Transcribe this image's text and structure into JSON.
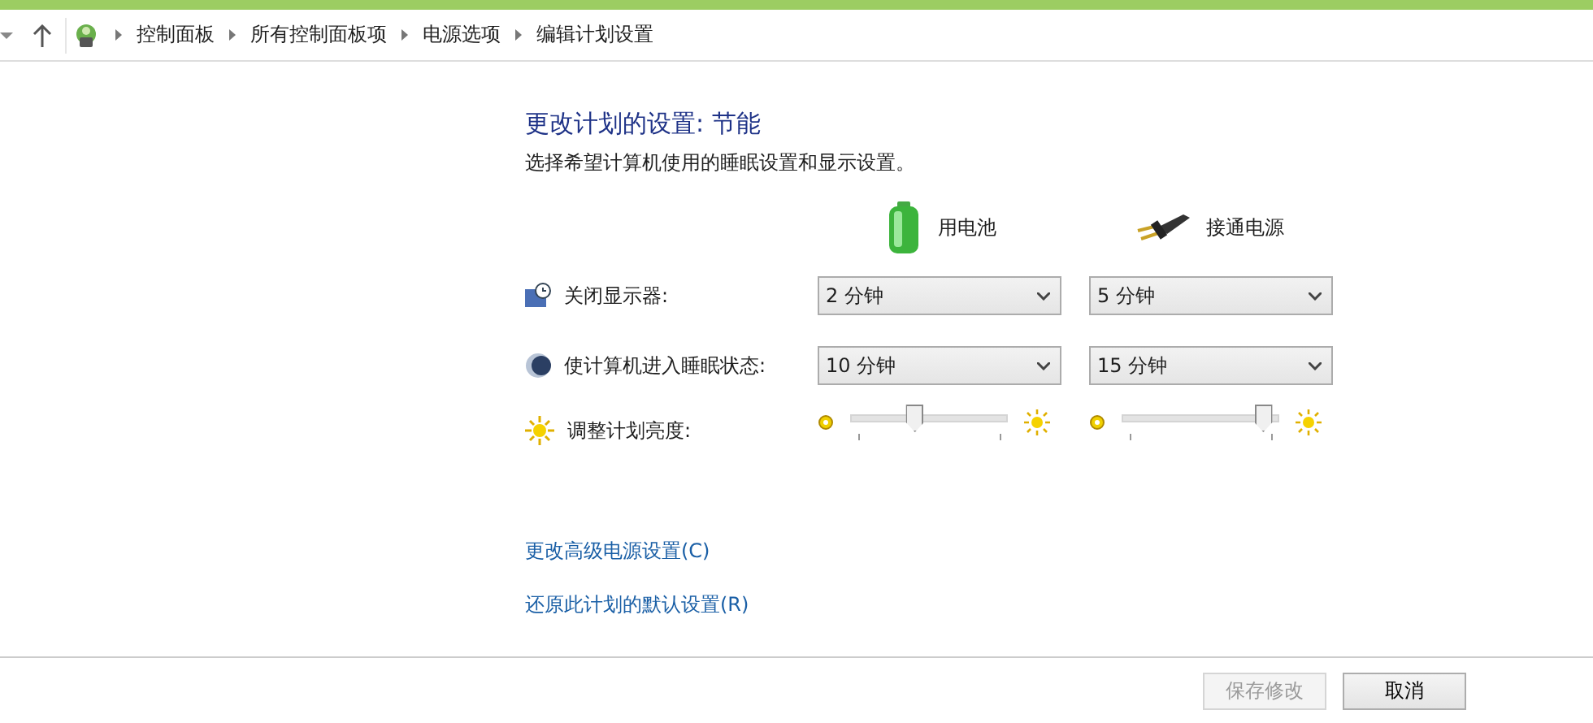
{
  "breadcrumb": [
    {
      "label": "控制面板"
    },
    {
      "label": "所有控制面板项"
    },
    {
      "label": "电源选项"
    },
    {
      "label": "编辑计划设置"
    }
  ],
  "heading": "更改计划的设置: 节能",
  "subtitle": "选择希望计算机使用的睡眠设置和显示设置。",
  "columns": [
    {
      "kind": "battery",
      "label": "用电池"
    },
    {
      "kind": "plug",
      "label": "接通电源"
    }
  ],
  "settings": [
    {
      "kind": "select",
      "label": "关闭显示器:",
      "values": [
        "2 分钟",
        "5 分钟"
      ]
    },
    {
      "kind": "select",
      "label": "使计算机进入睡眠状态:",
      "values": [
        "10 分钟",
        "15 分钟"
      ]
    },
    {
      "kind": "slider",
      "label": "调整计划亮度:",
      "levels": [
        {
          "level": 0.4
        },
        {
          "level": 0.95
        }
      ]
    }
  ],
  "links": [
    "更改高级电源设置(C)",
    "还原此计划的默认设置(R)"
  ],
  "buttons": [
    {
      "label": "保存修改",
      "disabled": true
    },
    {
      "label": "取消",
      "disabled": false
    }
  ]
}
